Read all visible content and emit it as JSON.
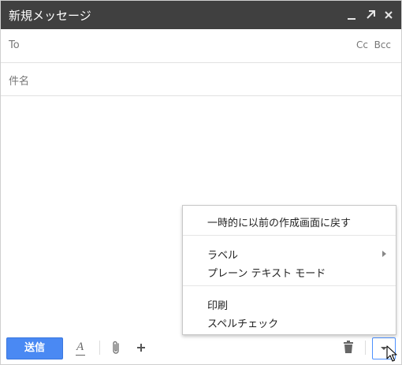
{
  "window": {
    "title": "新規メッセージ",
    "controls": [
      "minimize-icon",
      "pop-out-icon",
      "close-icon"
    ]
  },
  "compose": {
    "to_label": "To",
    "cc_label": "Cc",
    "bcc_label": "Bcc",
    "subject_placeholder": "件名",
    "body": ""
  },
  "toolbar": {
    "send_label": "送信",
    "format_icon": "format-text-icon",
    "attach_icon": "paperclip-icon",
    "insert_icon": "plus-icon",
    "discard_icon": "trash-icon",
    "more_icon": "caret-down-icon"
  },
  "more_menu": {
    "items": [
      {
        "label": "一時的に以前の作成画面に戻す"
      },
      {
        "label": "ラベル",
        "has_submenu": true
      },
      {
        "label": "プレーン テキスト モード"
      },
      {
        "label": "印刷"
      },
      {
        "label": "スペルチェック"
      }
    ]
  },
  "colors": {
    "titlebar_bg": "#404040",
    "send_button_bg": "#4a89f3",
    "focus_border": "#4d90fe"
  }
}
